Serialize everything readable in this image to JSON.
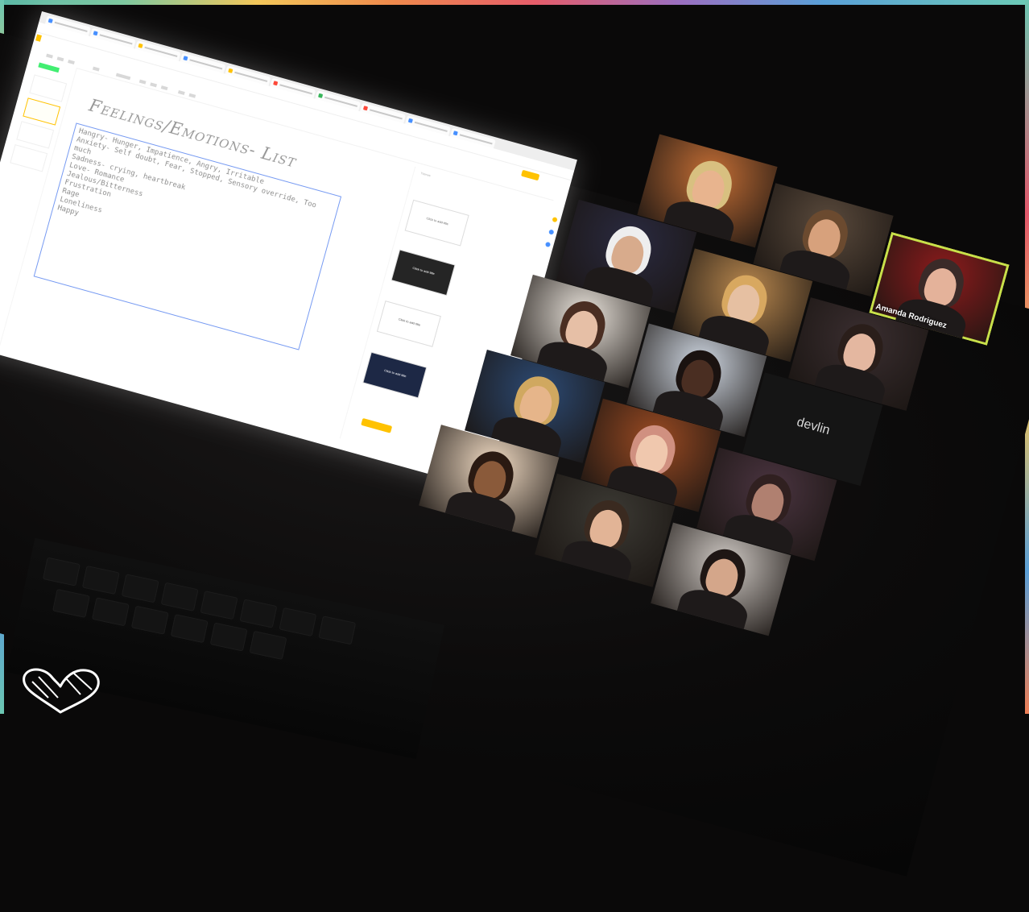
{
  "slides": {
    "title": "Feelings/Emotions- List",
    "lines": [
      "Hangry- Hunger, Impatience, Angry, Irritable",
      "Anxiety- Self doubt, Fear, Stopped, Sensory override, Too",
      "much",
      "Sadness- crying, heartbreak",
      "Love- Romance",
      "Jealous/Bitterness",
      "Frustration",
      "Rage",
      "Loneliness",
      "Happy"
    ],
    "themes_title": "Themes",
    "themes": [
      {
        "caption": "Click to add title",
        "bg": "#ffffff",
        "fg": "#444444"
      },
      {
        "caption": "Click to add title",
        "bg": "#222222",
        "fg": "#ffffff"
      },
      {
        "caption": "Click to add title",
        "bg": "#efefef",
        "fg": "#444444"
      },
      {
        "caption": "Click to add title",
        "bg": "#1b2540",
        "fg": "#ffffff"
      }
    ]
  },
  "participants": [
    {
      "id": "p1",
      "bg": "#c46e35",
      "skin": "#e8b48e",
      "hair": "#d8c080"
    },
    {
      "id": "p2",
      "bg": "#5a4a3c",
      "skin": "#d7a17c",
      "hair": "#6b4a2f"
    },
    {
      "id": "p3",
      "bg": "#8d1b1c",
      "skin": "#e4b29a",
      "hair": "#3a2a28",
      "name": "Amanda Rodriguez",
      "active": true
    },
    {
      "id": "p4",
      "bg": "#2a2a40",
      "skin": "#d8ab8c",
      "hair": "#eeeeee"
    },
    {
      "id": "p5",
      "bg": "#b8874e",
      "skin": "#e6c0a2",
      "hair": "#d8a860"
    },
    {
      "id": "p6",
      "bg": "#3a2e30",
      "skin": "#e4b7a0",
      "hair": "#2a1e1a"
    },
    {
      "id": "p7",
      "bg": "#eae4dc",
      "skin": "#e6bfa6",
      "hair": "#4a2e22"
    },
    {
      "id": "p8",
      "bg": "#cfd7e2",
      "skin": "#4a2e22",
      "hair": "#1a1210"
    },
    {
      "id": "p9",
      "bg": "#1a1a1a",
      "skin": "#000000",
      "hair": "#000000",
      "name": "devlin",
      "video_off": true
    },
    {
      "id": "p10",
      "bg": "#2c4a74",
      "skin": "#e6b58a",
      "hair": "#d0a860"
    },
    {
      "id": "p11",
      "bg": "#9a4a22",
      "skin": "#f0c8ae",
      "hair": "#d09080"
    },
    {
      "id": "p12",
      "bg": "#4a3440",
      "skin": "#b08070",
      "hair": "#302020"
    },
    {
      "id": "p13",
      "bg": "#f2dcc4",
      "skin": "#8a5a3a",
      "hair": "#2a1a12"
    },
    {
      "id": "p14",
      "bg": "#3c3a34",
      "skin": "#e2b496",
      "hair": "#3a2a20"
    },
    {
      "id": "p15",
      "bg": "#cfc9c4",
      "skin": "#d4a68a",
      "hair": "#1e1614"
    }
  ]
}
